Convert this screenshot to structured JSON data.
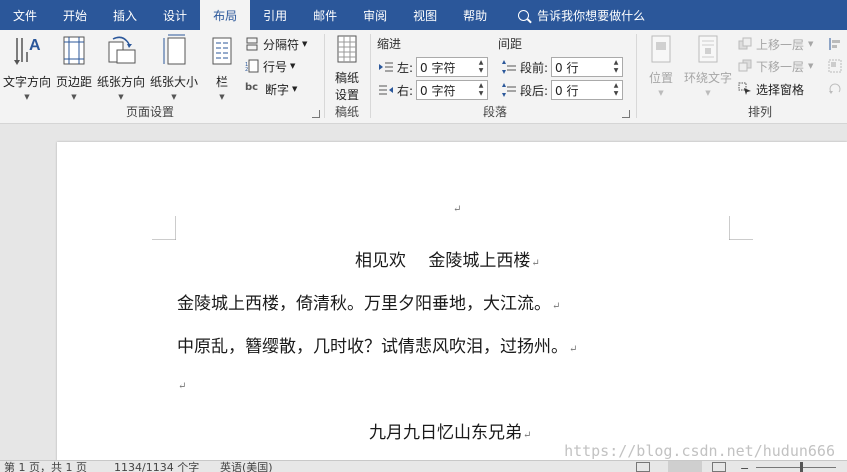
{
  "tabs": [
    {
      "label": "文件"
    },
    {
      "label": "开始"
    },
    {
      "label": "插入"
    },
    {
      "label": "设计"
    },
    {
      "label": "布局"
    },
    {
      "label": "引用"
    },
    {
      "label": "邮件"
    },
    {
      "label": "审阅"
    },
    {
      "label": "视图"
    },
    {
      "label": "帮助"
    }
  ],
  "active_tab": "布局",
  "tell_me": "告诉我你想要做什么",
  "page_setup": {
    "text_direction": "文字方向",
    "margins": "页边距",
    "orientation": "纸张方向",
    "size": "纸张大小",
    "columns": "栏",
    "breaks": "分隔符",
    "line_numbers": "行号",
    "hyphenation": "断字",
    "label": "页面设置"
  },
  "manuscript": {
    "button_line1": "稿纸",
    "button_line2": "设置",
    "label": "稿纸"
  },
  "paragraph": {
    "indent_label": "缩进",
    "spacing_label": "间距",
    "left_label": "左:",
    "right_label": "右:",
    "before_label": "段前:",
    "after_label": "段后:",
    "left_value": "0 字符",
    "right_value": "0 字符",
    "before_value": "0 行",
    "after_value": "0 行",
    "label": "段落"
  },
  "arrange": {
    "position": "位置",
    "wrap_text": "环绕文字",
    "bring_forward": "上移一层",
    "send_backward": "下移一层",
    "selection_pane": "选择窗格",
    "label": "排列"
  },
  "document": {
    "title_line": "相见欢　 金陵城上西楼",
    "line1": "金陵城上西楼，倚清秋。万里夕阳垂地，大江流。",
    "line2": "中原乱，簪缨散，几时收？试倩悲风吹泪，过扬州。",
    "line3": "九月九日忆山东兄弟",
    "paragraph_mark": "↵"
  },
  "watermark": "https://blog.csdn.net/hudun666",
  "status": {
    "page": "第 1 页，共 1 页",
    "words": "1134/1134 个字",
    "language": "英语(美国)"
  },
  "colors": {
    "tab_bar": "#2b579a",
    "ribbon_bg": "#f3f3f3",
    "doc_bg": "#e6e6e6"
  }
}
